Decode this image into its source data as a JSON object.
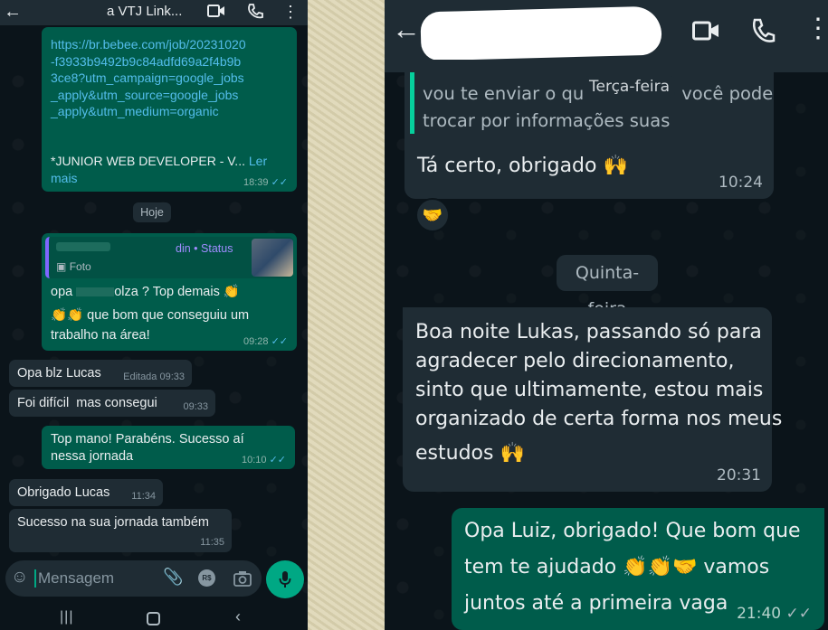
{
  "left": {
    "header": {
      "title": "a VTJ Link..."
    },
    "messages": {
      "link_msg": {
        "lines": [
          "https://br.bebee.com/job/20231020",
          "-f3933b9492b9c84adfd69a2f4b9b",
          "3ce8?utm_campaign=google_jobs",
          "_apply&utm_source=google_jobs",
          "_apply&utm_medium=organic"
        ],
        "job_text": "*JUNIOR WEB DEVELOPER - V...",
        "read_more": "Ler mais",
        "time": "18:39"
      },
      "date_today": "Hoje",
      "status_reply": {
        "quote_author": "din • Status",
        "quote_type": "Foto",
        "line1_a": "opa",
        "line1_b": "olza ? Top demais",
        "line2": "que bom que conseguiu um",
        "line3": "trabalho na área!",
        "time": "09:28"
      },
      "msg_blz": {
        "text": "Opa blz Lucas",
        "time": "Editada 09:33"
      },
      "msg_dificil": {
        "text": "Foi difícil  mas consegui",
        "time": "09:33"
      },
      "msg_topmano": {
        "line1": "Top mano! Parabéns. Sucesso aí",
        "line2": "nessa jornada",
        "time": "10:10"
      },
      "msg_obrigado": {
        "text": "Obrigado Lucas",
        "time": "11:34"
      },
      "msg_sucesso": {
        "text": "Sucesso na sua jornada também",
        "time": "11:35"
      }
    },
    "input": {
      "placeholder": "Mensagem"
    }
  },
  "right": {
    "messages": {
      "top_partial": {
        "line1_a": "vou te enviar o qu",
        "line1_b": "você pode",
        "line2": "trocar por informações suas",
        "overlay_day": "Terça-feira"
      },
      "ta_certo": {
        "text": "Tá certo, obrigado",
        "time": "10:24"
      },
      "date_quinta": "Quinta-feira",
      "boa_noite": {
        "lines": [
          "Boa noite Lukas, passando só para",
          "agradecer pelo direcionamento,",
          "sinto que ultimamente, estou mais",
          "organizado de certa forma nos meus",
          "estudos"
        ],
        "time": "20:31"
      },
      "opa_luiz": {
        "line1": "Opa Luiz, obrigado! Que bom que",
        "line2_a": "tem te ajudado",
        "line2_b": "vamos",
        "line3": "juntos até a primeira vaga",
        "time": "21:40"
      }
    }
  }
}
